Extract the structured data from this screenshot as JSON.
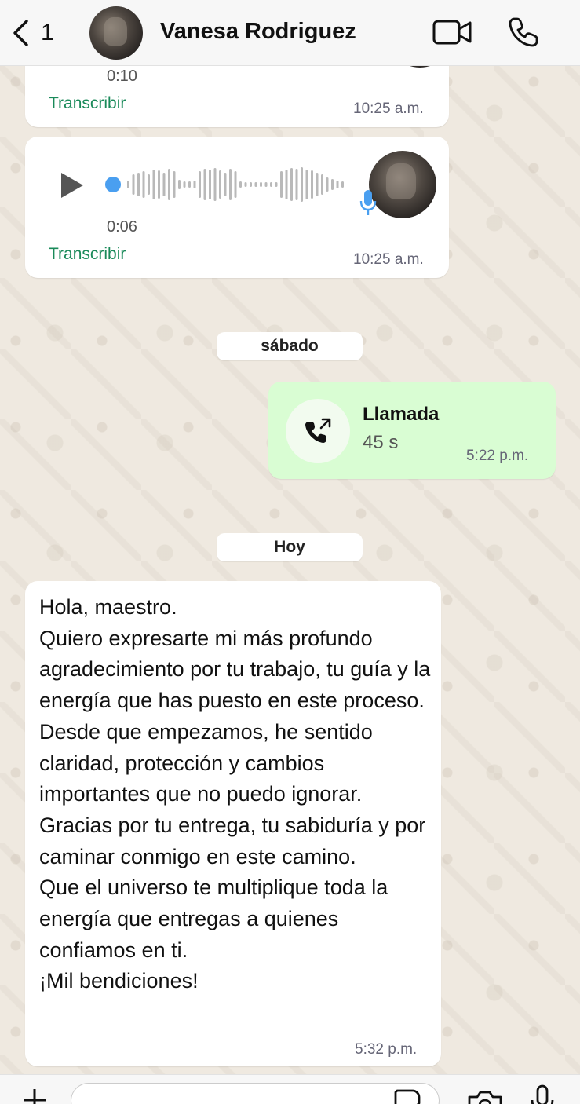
{
  "header": {
    "back_count": "1",
    "contact_name": "Vanesa Rodriguez",
    "icons": {
      "back": "chevron-left-icon",
      "video": "video-camera-icon",
      "phone": "phone-icon"
    }
  },
  "messages": {
    "audio_1": {
      "duration": "0:10",
      "transcribe_label": "Transcribir",
      "time": "10:25 a.m."
    },
    "audio_2": {
      "duration": "0:06",
      "transcribe_label": "Transcribir",
      "time": "10:25 a.m.",
      "progress": 0
    },
    "date_saturday": "sábado",
    "call": {
      "title": "Llamada",
      "duration": "45 s",
      "time": "5:22 p.m."
    },
    "date_today": "Hoy",
    "text_message": {
      "body": "Hola, maestro.\nQuiero expresarte mi más profundo agradecimiento por tu trabajo, tu guía y la energía que has puesto en este proceso.\nDesde que empezamos, he sentido claridad, protección y cambios importantes que no puedo ignorar.\nGracias por tu entrega, tu sabiduría y por caminar conmigo en este camino.\nQue el universo te multiplique toda la energía que entregas a quienes confiamos en ti.\n¡Mil bendiciones!",
      "time": "5:32 p.m."
    }
  },
  "compose": {
    "placeholder": "",
    "icons": {
      "plus": "plus-icon",
      "sticker": "sticker-icon",
      "camera": "camera-icon",
      "mic": "microphone-icon"
    }
  },
  "colors": {
    "outgoing_bubble": "#d9fdd3",
    "incoming_bubble": "#ffffff",
    "transcribe_green": "#1a8a5a",
    "audio_accent": "#4a9ff0"
  }
}
